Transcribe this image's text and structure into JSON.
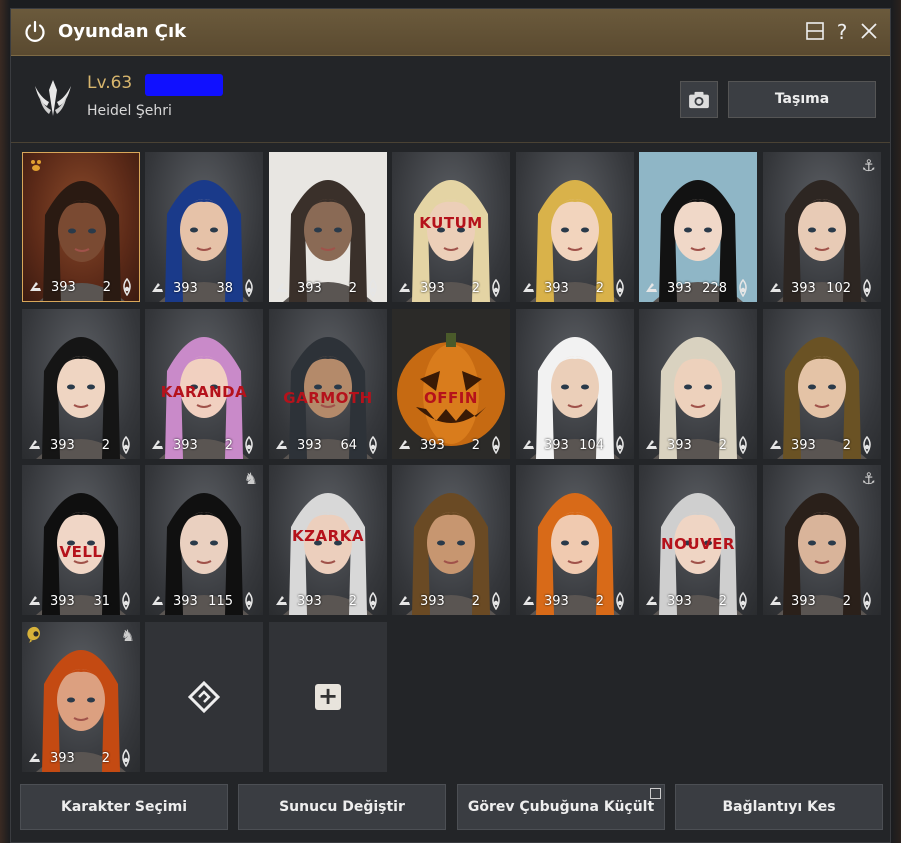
{
  "window": {
    "title": "Oyundan Çık"
  },
  "header": {
    "level": "Lv.63",
    "city": "Heidel Şehri",
    "move_label": "Taşıma"
  },
  "characters": [
    {
      "gs": "393",
      "count": "2",
      "name": ""
    },
    {
      "gs": "393",
      "count": "38",
      "name": ""
    },
    {
      "gs": "393",
      "count": "2",
      "name": ""
    },
    {
      "gs": "393",
      "count": "2",
      "name": "KUTUM"
    },
    {
      "gs": "393",
      "count": "2",
      "name": ""
    },
    {
      "gs": "393",
      "count": "228",
      "name": ""
    },
    {
      "gs": "393",
      "count": "102",
      "name": ""
    },
    {
      "gs": "393",
      "count": "2",
      "name": ""
    },
    {
      "gs": "393",
      "count": "2",
      "name": "KARANDA"
    },
    {
      "gs": "393",
      "count": "64",
      "name": "GARMOTH"
    },
    {
      "gs": "393",
      "count": "2",
      "name": "OFFIN"
    },
    {
      "gs": "393",
      "count": "104",
      "name": ""
    },
    {
      "gs": "393",
      "count": "2",
      "name": ""
    },
    {
      "gs": "393",
      "count": "2",
      "name": ""
    },
    {
      "gs": "393",
      "count": "31",
      "name": "VELL"
    },
    {
      "gs": "393",
      "count": "115",
      "name": ""
    },
    {
      "gs": "393",
      "count": "2",
      "name": "KZARKA"
    },
    {
      "gs": "393",
      "count": "2",
      "name": ""
    },
    {
      "gs": "393",
      "count": "2",
      "name": ""
    },
    {
      "gs": "393",
      "count": "2",
      "name": "NOUVER"
    },
    {
      "gs": "393",
      "count": "2",
      "name": ""
    },
    {
      "gs": "393",
      "count": "2",
      "name": ""
    }
  ],
  "footer": {
    "char_select": "Karakter Seçimi",
    "change_server": "Sunucu Değiştir",
    "minimize": "Görev Çubuğuna Küçült",
    "disconnect": "Bağlantıyı Kes"
  },
  "colors": {
    "title_bar": "#5e4d33",
    "accent_gold": "#d7b56d",
    "name_red": "#b5121b",
    "selected_border": "#d8a75a"
  },
  "icons": {
    "power": "power-icon",
    "window": "window-icon",
    "help": "help-icon",
    "close": "close-icon",
    "camera": "camera-icon",
    "anchor": "anchor-icon",
    "horse": "horse-icon",
    "gear": "gear-icon",
    "energy": "energy-icon",
    "plus": "plus-icon",
    "slot": "slot-diamond-icon"
  }
}
